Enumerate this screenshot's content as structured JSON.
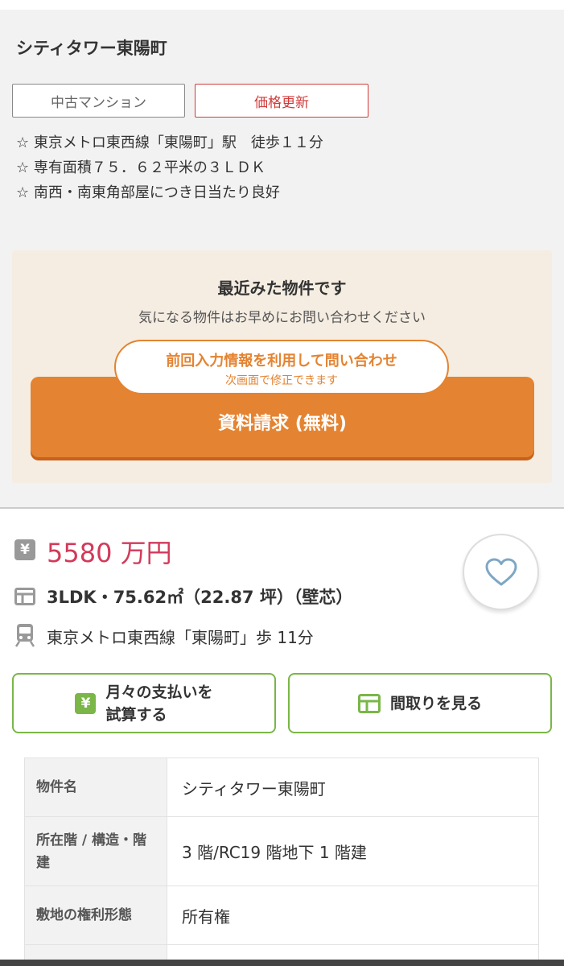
{
  "header": {
    "title": "シティタワー東陽町",
    "tags": [
      "中古マンション",
      "価格更新"
    ],
    "features": [
      "☆ 東京メトロ東西線「東陽町」駅　徒歩１１分",
      "☆ 専有面積７５．６２平米の３ＬＤＫ",
      "☆ 南西・南東角部屋につき日当たり良好"
    ]
  },
  "cta": {
    "heading": "最近みた物件です",
    "subheading": "気になる物件はお早めにお問い合わせください",
    "reuse_main": "前回入力情報を利用して問い合わせ",
    "reuse_sub": "次画面で修正できます",
    "request_label": "資料請求 (無料)"
  },
  "summary": {
    "price": "5580 万円",
    "spec": "3LDK・75.62㎡（22.87 坪）（壁芯）",
    "access": "東京メトロ東西線「東陽町」歩 11分"
  },
  "buttons": {
    "payment_line1": "月々の支払いを",
    "payment_line2": "試算する",
    "floorplan": "間取りを見る"
  },
  "table": {
    "rows": [
      {
        "label": "物件名",
        "value": "シティタワー東陽町"
      },
      {
        "label": "所在階 / 構造・階建",
        "value": "3 階/RC19 階地下 1 階建"
      },
      {
        "label": "敷地の権利形態",
        "value": "所有権"
      }
    ]
  },
  "icons": {
    "yen": "yen-icon",
    "floorplan": "floorplan-icon",
    "train": "train-icon",
    "heart": "heart-icon"
  },
  "colors": {
    "accent_orange": "#e48331",
    "price_red": "#d23a5a",
    "tag_red": "#d23a3a",
    "green": "#7ab648"
  }
}
